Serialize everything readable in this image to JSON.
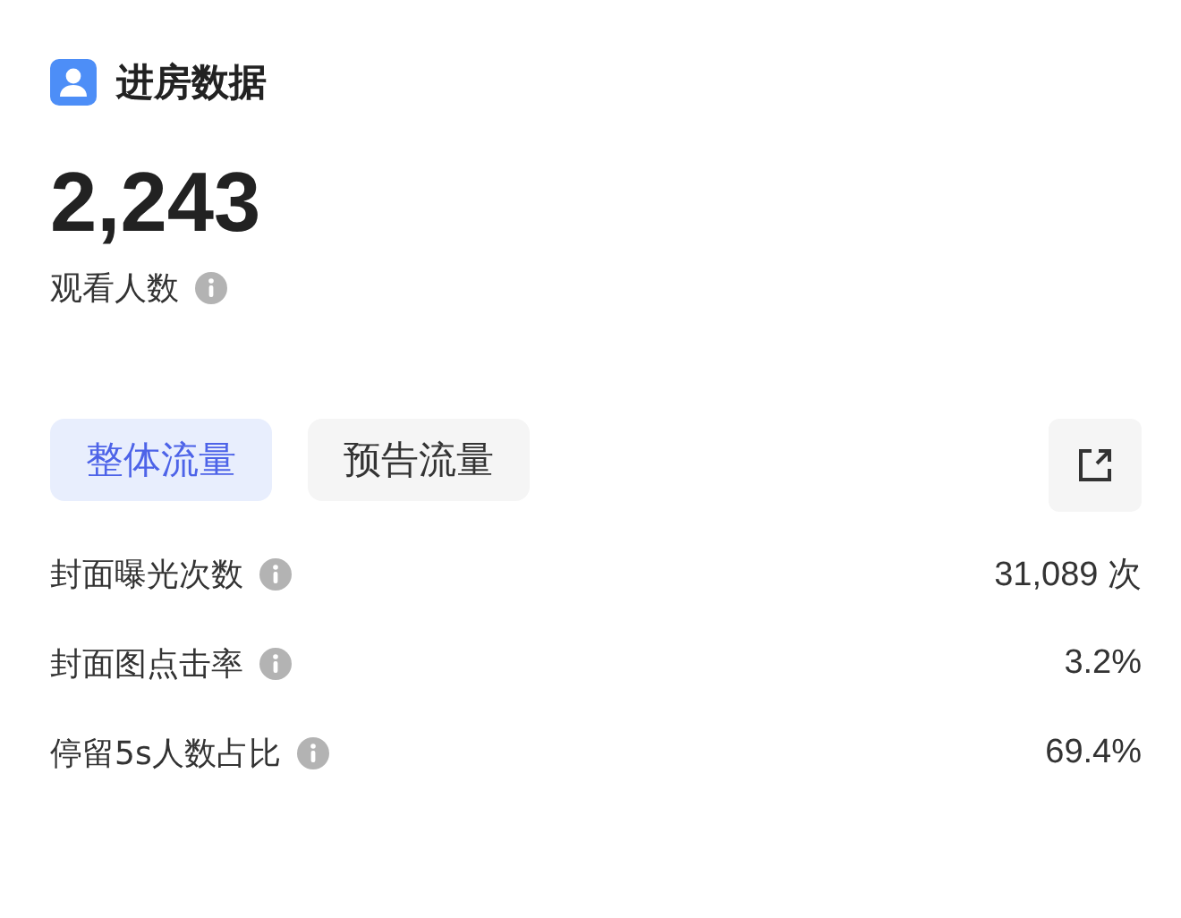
{
  "header": {
    "title": "进房数据"
  },
  "summary": {
    "value": "2,243",
    "label": "观看人数"
  },
  "tabs": [
    {
      "label": "整体流量",
      "selected": true
    },
    {
      "label": "预告流量",
      "selected": false
    }
  ],
  "metrics": [
    {
      "label": "封面曝光次数",
      "value": "31,089 次"
    },
    {
      "label": "封面图点击率",
      "value": "3.2%"
    },
    {
      "label": "停留5s人数占比",
      "value": "69.4%"
    }
  ]
}
